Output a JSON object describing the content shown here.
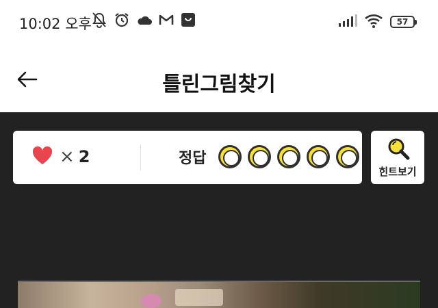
{
  "status_bar": {
    "time": "10:02 오후",
    "icons_left": [
      "mute-bell-icon",
      "alarm-clock-icon",
      "cloud-icon",
      "gmail-icon",
      "shopping-bag-icon"
    ],
    "icons_right": [
      "signal-icon",
      "wifi-icon",
      "battery-icon"
    ],
    "battery_level": "57"
  },
  "header": {
    "back_icon": "arrow-left-icon",
    "title": "틀린그림찾기"
  },
  "score_panel": {
    "lives_icon": "heart-icon",
    "lives_times": "×",
    "lives_count": "2",
    "answer_label": "정답",
    "answers_total": 5,
    "answers_found": 0
  },
  "hint_button": {
    "icon": "magnifier-icon",
    "label": "힌트보기"
  },
  "colors": {
    "background": "#222222",
    "panel": "#ffffff",
    "accent_yellow": "#f7df3c",
    "heart_red": "#e8454e"
  }
}
